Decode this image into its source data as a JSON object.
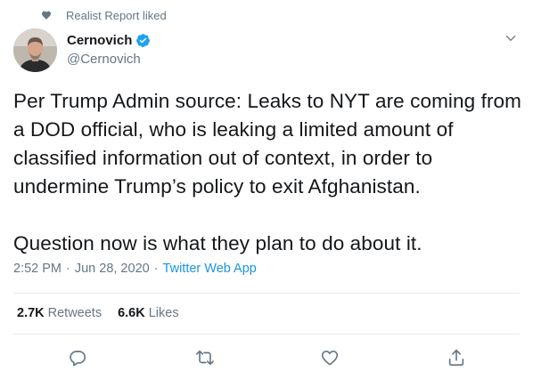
{
  "social_context": {
    "icon": "heart-icon",
    "text": "Realist Report liked"
  },
  "author": {
    "name": "Cernovich",
    "handle": "@Cernovich",
    "verified_icon": "verified-badge-icon"
  },
  "tweet": {
    "text": "Per Trump Admin source: Leaks to NYT are coming from\na DOD official, who is leaking a limited amount of\nclassified information out of context, in order to\nundermine Trump’s policy to exit Afghanistan.\n\nQuestion now is what they plan to do about it.",
    "time": "2:52 PM",
    "separator": "·",
    "date": "Jun 28, 2020",
    "source": "Twitter Web App"
  },
  "stats": {
    "retweets_count": "2.7K",
    "retweets_label": "Retweets",
    "likes_count": "6.6K",
    "likes_label": "Likes"
  },
  "actions": [
    "reply-icon",
    "retweet-icon",
    "like-icon",
    "share-icon"
  ],
  "colors": {
    "text": "#14171a",
    "secondary": "#657786",
    "link": "#1b95e0",
    "verified": "#1da1f2",
    "divider": "#e6ecf0"
  }
}
